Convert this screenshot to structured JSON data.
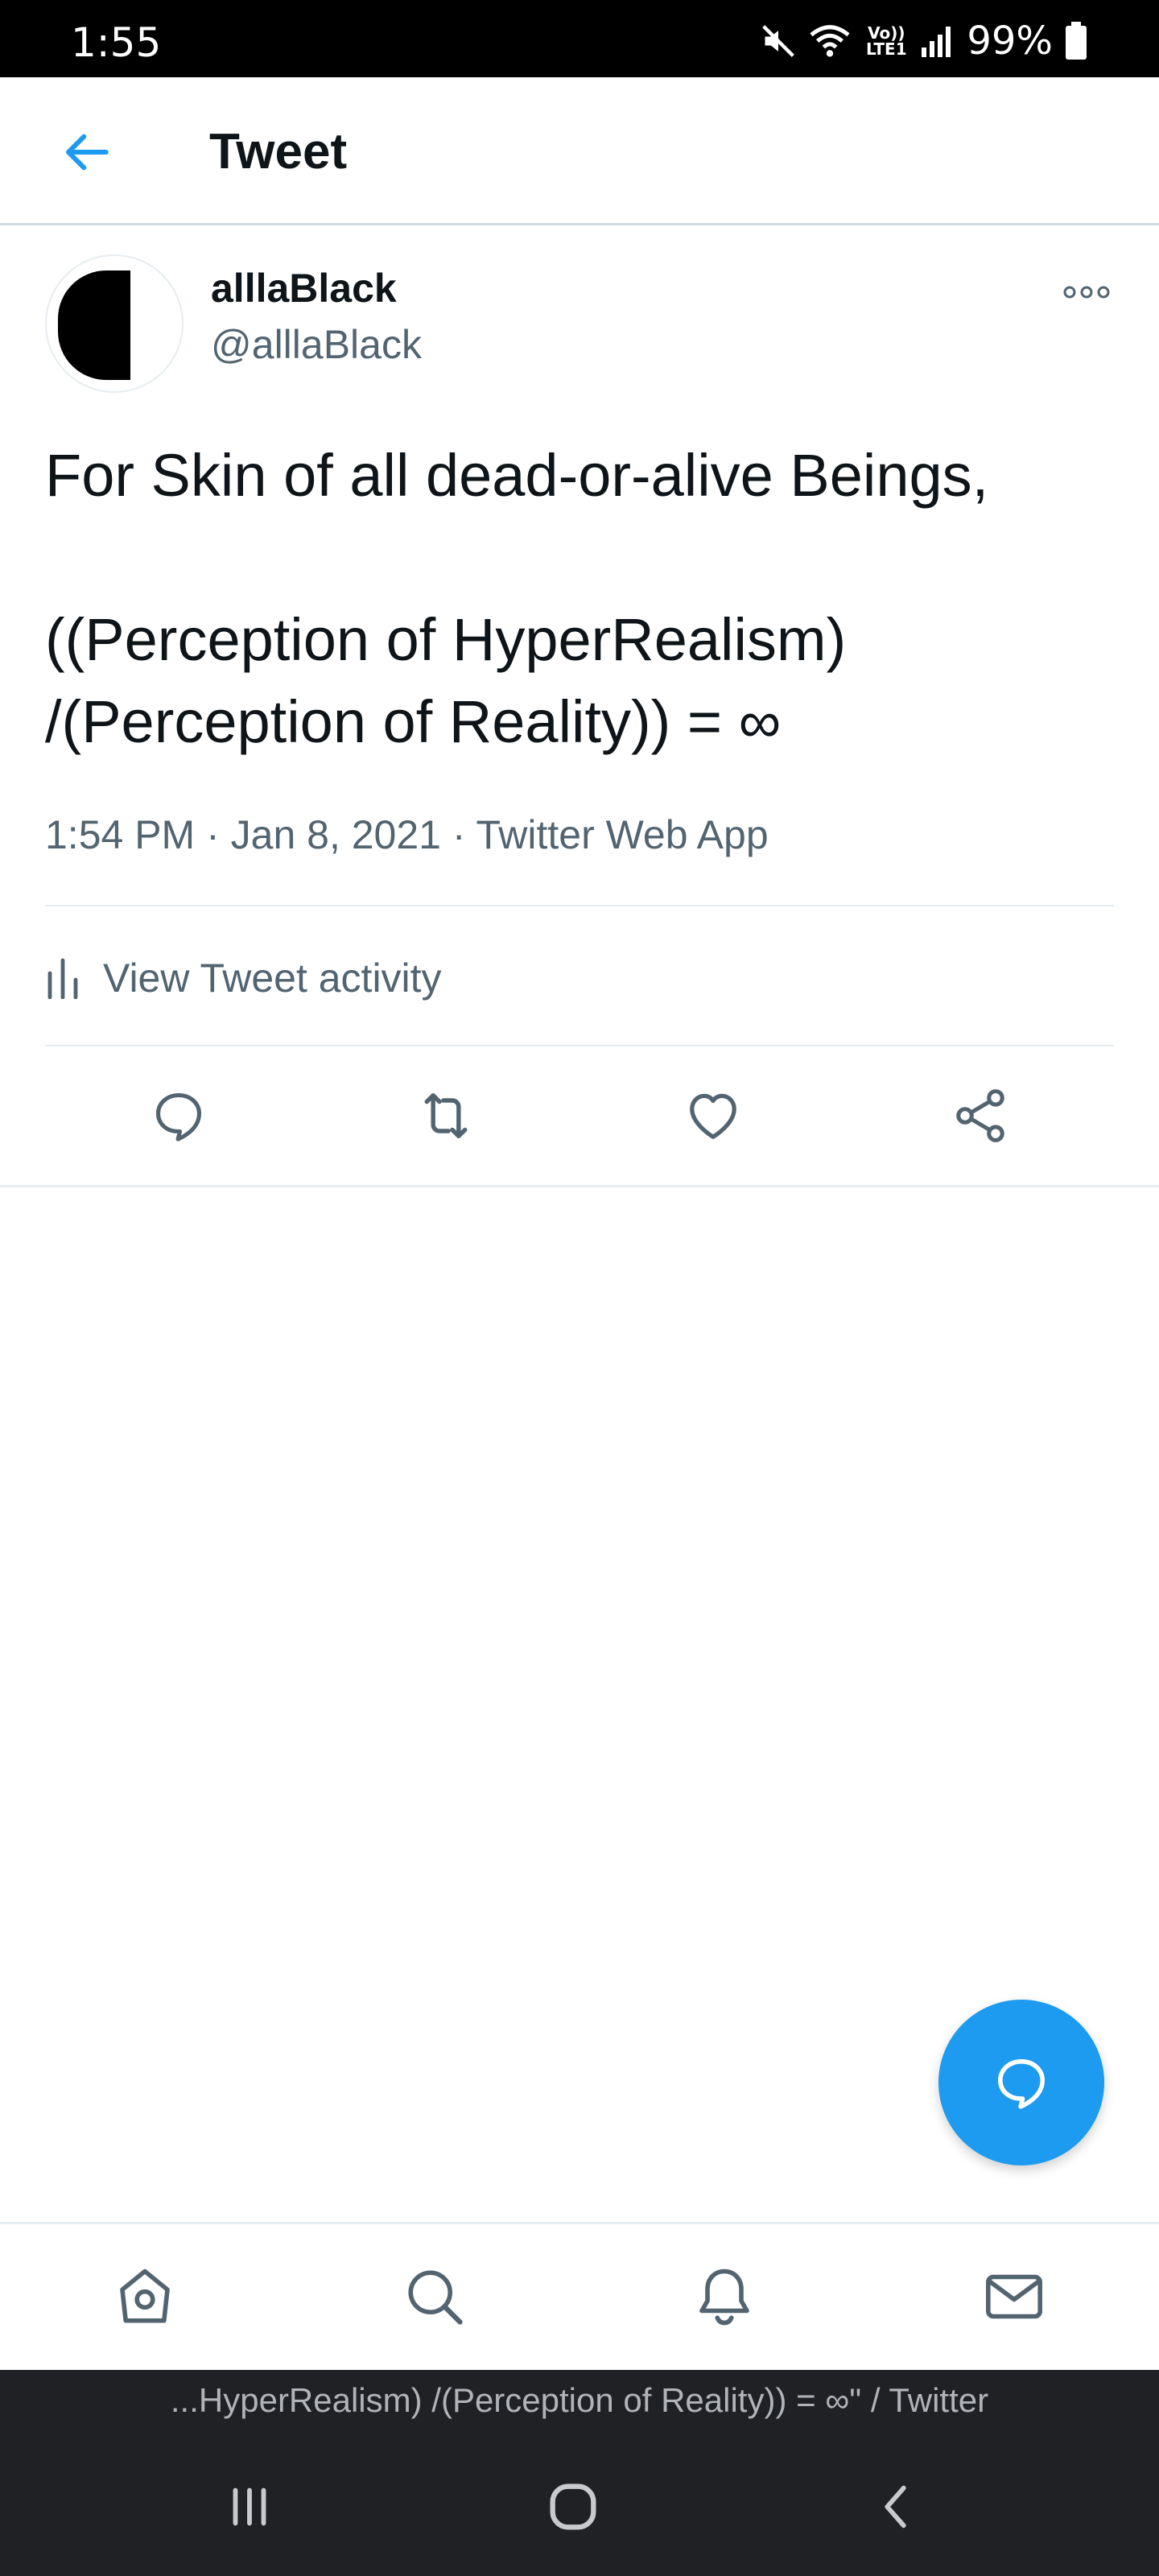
{
  "status_bar": {
    "time": "1:55",
    "network_label": "Vo)) LTE1",
    "battery_percent": "99%",
    "icons": [
      "mute-icon",
      "wifi-icon",
      "signal-icon",
      "battery-icon"
    ]
  },
  "header": {
    "title": "Tweet",
    "back_icon": "arrow-left-icon"
  },
  "tweet": {
    "author_name": "alllaBlack",
    "author_handle": "@alllaBlack",
    "text_lines": [
      "For Skin of all dead-or-alive Beings,",
      "",
      "((Perception of HyperRealism)",
      "/(Perception of Reality)) = ∞"
    ],
    "meta": "1:54 PM · Jan 8, 2021 · Twitter Web App",
    "activity_label": "View Tweet activity"
  },
  "actions": [
    "reply-icon",
    "retweet-icon",
    "like-icon",
    "share-icon"
  ],
  "bottom_nav": [
    "home-icon",
    "search-icon",
    "notifications-icon",
    "messages-icon"
  ],
  "system": {
    "window_caption": "...HyperRealism) /(Perception of Reality)) = ∞\" / Twitter",
    "buttons": [
      "recents-icon",
      "home-circle-icon",
      "back-chevron-icon"
    ]
  },
  "colors": {
    "accent": "#1d9bf0",
    "text_primary": "#0f1419",
    "text_secondary": "#536471",
    "divider": "#e6ecf0",
    "system_bar": "#202124"
  }
}
